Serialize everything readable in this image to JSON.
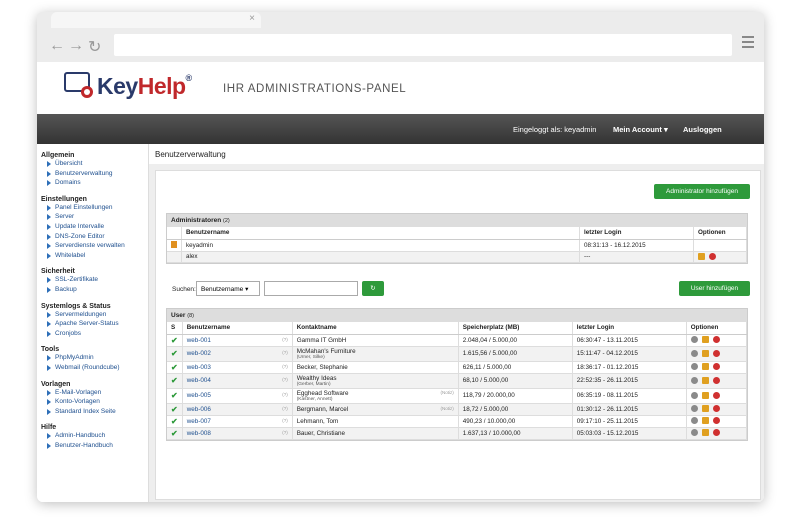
{
  "browser": {
    "back_icon": "←",
    "forward_icon": "→",
    "reload_icon": "↻",
    "close_tab": "×"
  },
  "brand": {
    "name_key": "Key",
    "name_help": "Help",
    "reg": "®",
    "tagline": "IHR ADMINISTRATIONS-PANEL"
  },
  "topbar": {
    "logged_in": "Eingeloggt als: keyadmin",
    "account": "Mein Account ▾",
    "logout": "Ausloggen"
  },
  "sidebar": {
    "sections": [
      {
        "title": "Allgemein",
        "items": [
          "Übersicht",
          "Benutzerverwaltung",
          "Domains"
        ]
      },
      {
        "title": "Einstellungen",
        "items": [
          "Panel Einstellungen",
          "Server",
          "Update Intervalle",
          "DNS-Zone Editor",
          "Serverdienste verwalten",
          "Whitelabel"
        ]
      },
      {
        "title": "Sicherheit",
        "items": [
          "SSL-Zertifikate",
          "Backup"
        ]
      },
      {
        "title": "Systemlogs & Status",
        "items": [
          "Servermeldungen",
          "Apache Server-Status",
          "Cronjobs"
        ]
      },
      {
        "title": "Tools",
        "items": [
          "PhpMyAdmin",
          "Webmail (Roundcube)"
        ]
      },
      {
        "title": "Vorlagen",
        "items": [
          "E-Mail-Vorlagen",
          "Konto-Vorlagen",
          "Standard Index Seite"
        ]
      },
      {
        "title": "Hilfe",
        "items": [
          "Admin-Handbuch",
          "Benutzer-Handbuch"
        ]
      }
    ]
  },
  "main": {
    "title": "Benutzerverwaltung",
    "add_admin": "Administrator hinzufügen",
    "add_user": "User hinzufügen",
    "search_label": "Suchen:",
    "search_field": "Benutzername",
    "search_go": "↻"
  },
  "admins": {
    "title": "Administratoren",
    "count": "(2)",
    "headers": [
      "Benutzername",
      "letzter Login",
      "Optionen"
    ],
    "rows": [
      {
        "name": "keyadmin",
        "login": "08:31:13 - 16.12.2015"
      },
      {
        "name": "alex",
        "login": "---"
      }
    ]
  },
  "users": {
    "title": "User",
    "count": "(8)",
    "headers": [
      "S",
      "Benutzername",
      "Kontaktname",
      "Speicherplatz (MB)",
      "letzter Login",
      "Optionen"
    ],
    "rows": [
      {
        "name": "web-001",
        "contact": "Gamma IT GmbH",
        "sub": "",
        "note": "",
        "space": "2.048,04 / 5.000,00",
        "login": "06:30:47 - 13.11.2015"
      },
      {
        "name": "web-002",
        "contact": "McMahan's Furniture",
        "sub": "(Urner, Silke)",
        "note": "",
        "space": "1.615,56 / 5.000,00",
        "login": "15:11:47 - 04.12.2015"
      },
      {
        "name": "web-003",
        "contact": "Becker, Stephanie",
        "sub": "",
        "note": "",
        "space": "626,11 / 5.000,00",
        "login": "18:36:17 - 01.12.2015"
      },
      {
        "name": "web-004",
        "contact": "Wealthy Ideas",
        "sub": "(Gerber, Martin)",
        "note": "",
        "space": "68,10 / 5.000,00",
        "login": "22:52:35 - 26.11.2015"
      },
      {
        "name": "web-005",
        "contact": "Egghead Software",
        "sub": "(Kastner, Annett)",
        "note": "(Notiz)",
        "space": "118,79 / 20.000,00",
        "login": "06:35:19 - 08.11.2015"
      },
      {
        "name": "web-006",
        "contact": "Bergmann, Marcel",
        "sub": "",
        "note": "(Notiz)",
        "space": "18,72 / 5.000,00",
        "login": "01:30:12 - 26.11.2015"
      },
      {
        "name": "web-007",
        "contact": "Lehmann, Tom",
        "sub": "",
        "note": "",
        "space": "490,23 / 10.000,00",
        "login": "09:17:10 - 25.11.2015"
      },
      {
        "name": "web-008",
        "contact": "Bauer, Christiane",
        "sub": "",
        "note": "",
        "space": "1.637,13 / 10.000,00",
        "login": "05:03:03 - 15.12.2015"
      }
    ],
    "info_marker": "(?)",
    "status": "✔"
  }
}
